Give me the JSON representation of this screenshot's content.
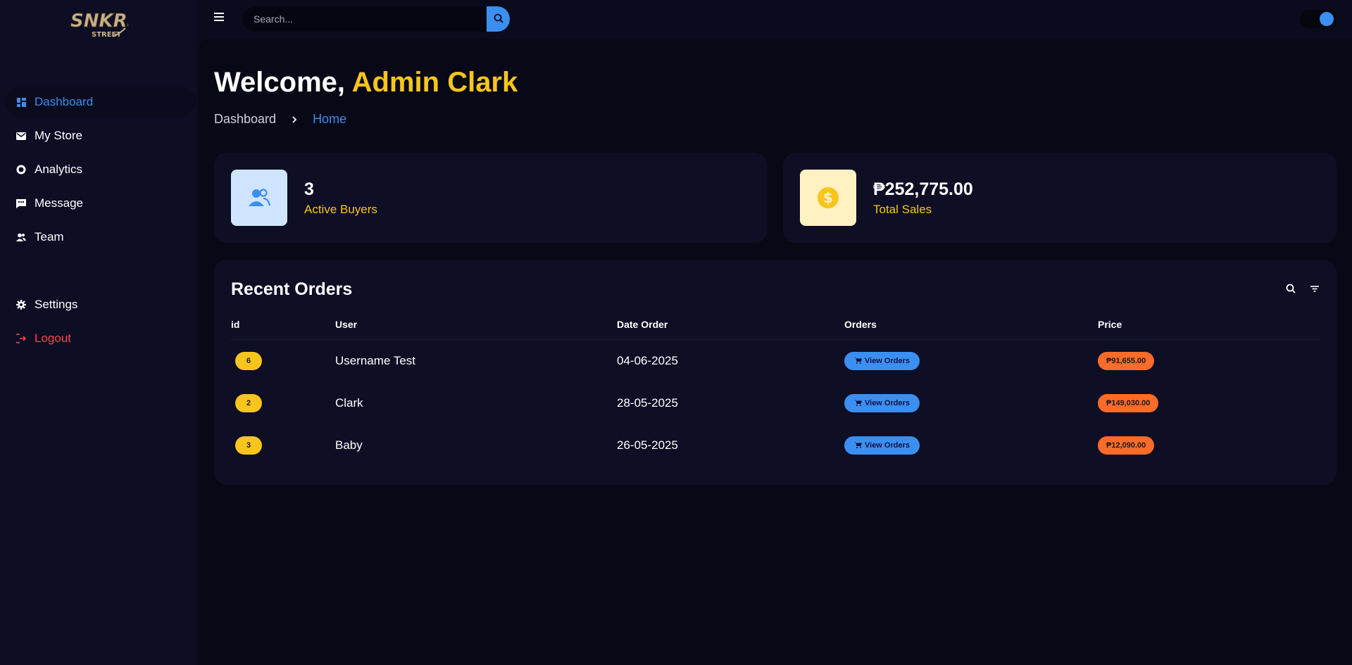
{
  "brand": {
    "logo_text_top": "SNKRS",
    "logo_text_bottom": "STREET"
  },
  "sidebar": {
    "items": [
      {
        "label": "Dashboard",
        "icon": "dashboard-icon",
        "active": true
      },
      {
        "label": "My Store",
        "icon": "mail-icon"
      },
      {
        "label": "Analytics",
        "icon": "donut-chart-icon"
      },
      {
        "label": "Message",
        "icon": "chat-icon"
      },
      {
        "label": "Team",
        "icon": "team-icon"
      }
    ],
    "bottom_items": [
      {
        "label": "Settings",
        "icon": "gear-icon"
      },
      {
        "label": "Logout",
        "icon": "logout-icon"
      }
    ]
  },
  "topbar": {
    "search_placeholder": "Search...",
    "theme_toggle_on": true
  },
  "page": {
    "welcome_prefix": "Welcome,",
    "welcome_name": "Admin Clark",
    "breadcrumb": [
      "Dashboard",
      "Home"
    ]
  },
  "stats": [
    {
      "value": "3",
      "label": "Active Buyers",
      "icon": "users-icon"
    },
    {
      "value": "₱252,775.00",
      "label": "Total Sales",
      "icon": "dollar-coin-icon"
    }
  ],
  "recent_orders": {
    "title": "Recent Orders",
    "columns": [
      "id",
      "User",
      "Date Order",
      "Orders",
      "Price"
    ],
    "rows": [
      {
        "id": "6",
        "user": "Username Test",
        "date": "04-06-2025",
        "orders_label": "View Orders",
        "price": "₱91,655.00"
      },
      {
        "id": "2",
        "user": "Clark",
        "date": "28-05-2025",
        "orders_label": "View Orders",
        "price": "₱149,030.00"
      },
      {
        "id": "3",
        "user": "Baby",
        "date": "26-05-2025",
        "orders_label": "View Orders",
        "price": "₱12,090.00"
      }
    ]
  },
  "colors": {
    "accent": "#3b8ff0",
    "highlight": "#f7c51c",
    "price": "#fb6b2a",
    "danger": "#f24848",
    "background": "#080816"
  }
}
